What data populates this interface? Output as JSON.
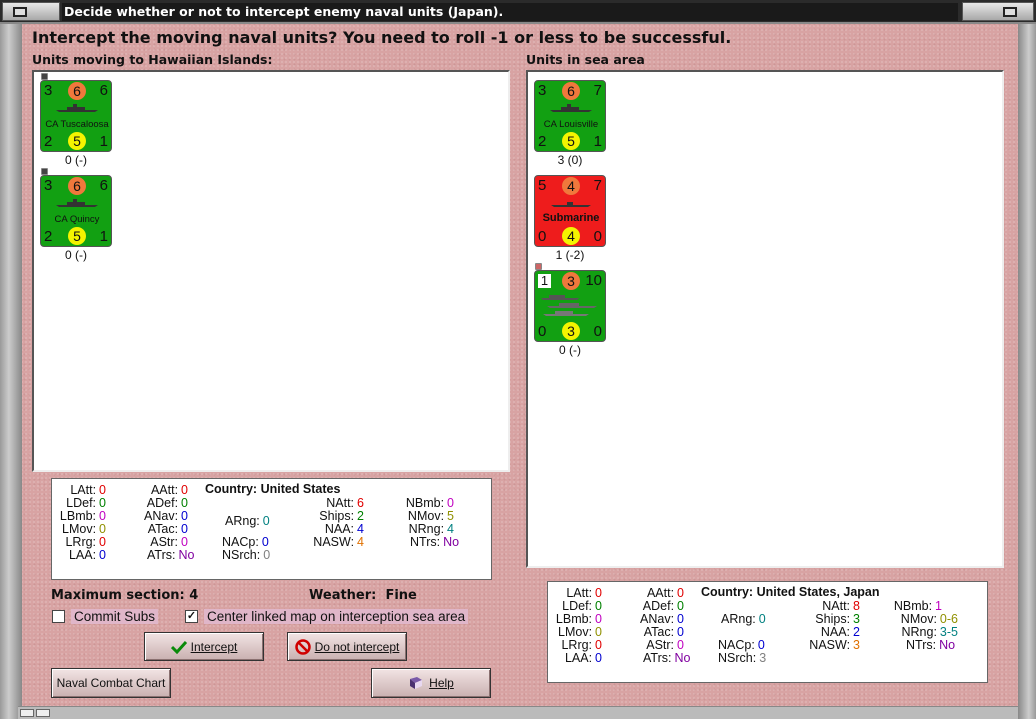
{
  "window": {
    "title": "Decide whether or not to intercept enemy naval units (Japan)."
  },
  "prompt": "Intercept the moving naval units?  You need to roll -1 or less to be successful.",
  "left_header": "Units moving to Hawaiian Islands:",
  "right_header": "Units in sea area",
  "moving_units": [
    {
      "tl": "3",
      "tc": "6",
      "tr": "6",
      "name": "CA Tuscaloosa",
      "bl": "2",
      "bc": "5",
      "br": "1",
      "label": "0 (-)"
    },
    {
      "tl": "3",
      "tc": "6",
      "tr": "6",
      "name": "CA Quincy",
      "bl": "2",
      "bc": "5",
      "br": "1",
      "label": "0 (-)"
    }
  ],
  "sea_units": [
    {
      "tl": "3",
      "tc": "6",
      "tr": "7",
      "name": "CA Louisville",
      "bl": "2",
      "bc": "5",
      "br": "1",
      "label": "3 (0)"
    },
    {
      "tl": "5",
      "tc": "4",
      "tr": "7",
      "name": "Submarine",
      "bl": "0",
      "bc": "4",
      "br": "0",
      "label": "1 (-2)"
    },
    {
      "tl": "1",
      "tc": "3",
      "tr": "10",
      "name": "",
      "bl": "0",
      "bc": "3",
      "br": "0",
      "label": "0 (-)"
    }
  ],
  "left_stats": {
    "country_label": "Country:",
    "country": "United States",
    "LAtt": "0",
    "LDef": "0",
    "LBmb": "0",
    "LMov": "0",
    "LRrg": "0",
    "LAA": "0",
    "AAtt": "0",
    "ADef": "0",
    "ANav": "0",
    "ATac": "0",
    "AStr": "0",
    "ATrs": "No",
    "ARng": "0",
    "NACp": "0",
    "NSrch": "0",
    "NAtt": "6",
    "Ships": "2",
    "NAA": "4",
    "NASW": "4",
    "NBmb": "0",
    "NMov": "5",
    "NRng": "4",
    "NTrs": "No"
  },
  "right_stats": {
    "country_label": "Country:",
    "country": "United States, Japan",
    "LAtt": "0",
    "LDef": "0",
    "LBmb": "0",
    "LMov": "0",
    "LRrg": "0",
    "LAA": "0",
    "AAtt": "0",
    "ADef": "0",
    "ANav": "0",
    "ATac": "0",
    "AStr": "0",
    "ATrs": "No",
    "ARng": "0",
    "NACp": "0",
    "NSrch": "3",
    "NAtt": "8",
    "Ships": "3",
    "NAA": "2",
    "NASW": "3",
    "NBmb": "1",
    "NMov": "0-6",
    "NRng": "3-5",
    "NTrs": "No"
  },
  "info": {
    "max_section_label": "Maximum section:",
    "max_section": "4",
    "weather_label": "Weather:",
    "weather": "Fine"
  },
  "checkboxes": {
    "commit_subs": {
      "label": "Commit Subs",
      "checked": false
    },
    "center_map": {
      "label": "Center linked map on interception sea area",
      "checked": true
    }
  },
  "buttons": {
    "intercept": "Intercept",
    "do_not_intercept": "Do not intercept",
    "naval_combat_chart": "Naval Combat Chart",
    "help": "Help"
  },
  "colors": {
    "zero_red": "#e00000",
    "green": "#008000",
    "magenta": "#c000c0",
    "blue": "#0000d0",
    "olive": "#909000",
    "teal": "#008080",
    "purple": "#8000a0",
    "orange": "#e07000",
    "gray": "#808080"
  }
}
